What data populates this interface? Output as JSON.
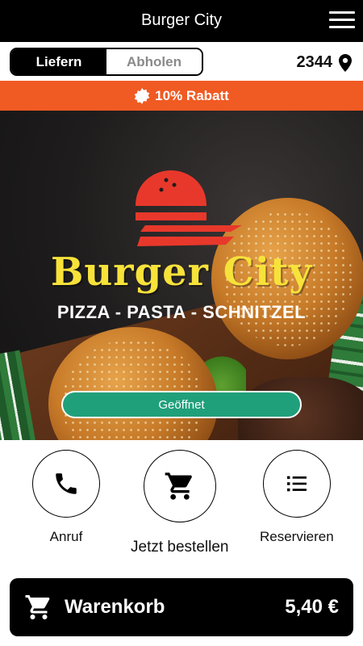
{
  "header": {
    "title": "Burger City",
    "menu_icon": "hamburger-menu-icon"
  },
  "order_mode": {
    "options": [
      {
        "label": "Liefern",
        "active": true
      },
      {
        "label": "Abholen",
        "active": false
      }
    ],
    "location_code": "2344",
    "location_icon": "map-pin-icon"
  },
  "discount": {
    "icon": "badge-icon",
    "text": "10% Rabatt",
    "color": "#f05a23"
  },
  "hero": {
    "brand": "Burger City",
    "tagline": "PIZZA - PASTA - SCHNITZEL",
    "status": "Geöffnet",
    "brand_color": "#f7e23a",
    "logo_color": "#e8382b",
    "status_color": "#20a07a"
  },
  "actions": [
    {
      "label": "Anruf",
      "icon": "phone-icon"
    },
    {
      "label": "Jetzt bestellen",
      "icon": "shopping-cart-icon"
    },
    {
      "label": "Reservieren",
      "icon": "list-icon"
    }
  ],
  "cart": {
    "label": "Warenkorb",
    "total": "5,40 €",
    "icon": "shopping-cart-icon"
  }
}
